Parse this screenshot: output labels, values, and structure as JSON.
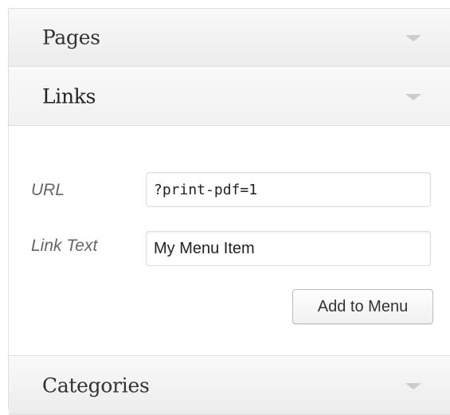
{
  "sections": {
    "pages": {
      "title": "Pages"
    },
    "links": {
      "title": "Links",
      "url_label": "URL",
      "url_value": "?print-pdf=1",
      "link_text_label": "Link Text",
      "link_text_value": "My Menu Item",
      "add_button_label": "Add to Menu"
    },
    "categories": {
      "title": "Categories"
    }
  },
  "icons": {
    "collapse_arrow": "triangle-down-icon"
  },
  "colors": {
    "header_bg": "#f1f1f1",
    "border": "#dfdfdf",
    "arrow": "#cccccc",
    "label_text": "#666666"
  }
}
